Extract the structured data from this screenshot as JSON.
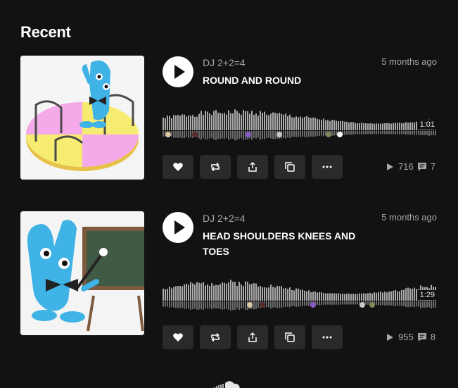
{
  "section": {
    "title": "Recent"
  },
  "tracks": [
    {
      "artist": "DJ 2+2=4",
      "title": "ROUND AND ROUND",
      "time_ago": "5 months ago",
      "duration": "1:01",
      "plays": "716",
      "comments": "7"
    },
    {
      "artist": "DJ 2+2=4",
      "title": "HEAD SHOULDERS KNEES AND TOES",
      "time_ago": "5 months ago",
      "duration": "1:29",
      "plays": "955",
      "comments": "8"
    }
  ],
  "icons": {
    "play": "play-icon",
    "like": "heart-icon",
    "repost": "repost-icon",
    "share": "share-icon",
    "copy": "copy-link-icon",
    "more": "more-icon",
    "plays": "play-count-icon",
    "comments": "comment-icon"
  },
  "colors": {
    "background": "#121212",
    "waveform": "#aaaaaa",
    "button": "#2a2a2a"
  }
}
